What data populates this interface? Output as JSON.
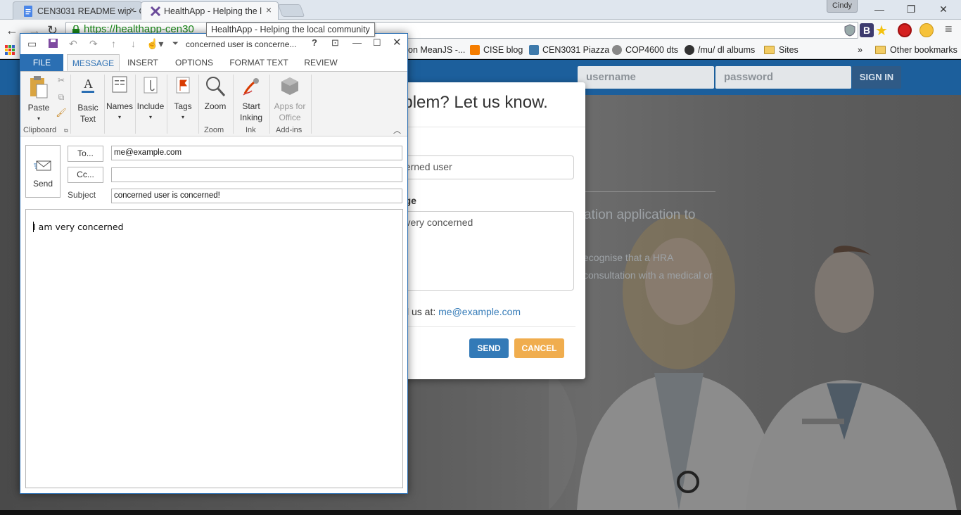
{
  "browser": {
    "tabs": [
      {
        "title": "CEN3031 README wip - C",
        "close": "×"
      },
      {
        "title": "HealthApp - Helping the l",
        "close": "×"
      }
    ],
    "profile_name": "Cindy",
    "url": "https://healthapp-cen30",
    "tooltip": "HealthApp - Helping the local community",
    "window_controls": {
      "minimize": "—",
      "restore": "❐",
      "close": "✕"
    },
    "bookmarks": [
      {
        "label": "on MeanJS -..."
      },
      {
        "label": "CISE blog"
      },
      {
        "label": "CEN3031 Piazza"
      },
      {
        "label": "COP4600 dts"
      },
      {
        "label": "/mu/ dl albums"
      },
      {
        "label": "Sites"
      }
    ],
    "overflow": "»",
    "other_bookmarks": "Other bookmarks",
    "extensions": {
      "b": "B",
      "menu": "≡"
    }
  },
  "site": {
    "username_placeholder": "username",
    "password_placeholder": "password",
    "signin_label": "SIGN IN",
    "bg_heading": "ation application to",
    "bg_line1": "ecognise that a HRA",
    "bg_line2": "consultation with a medical or"
  },
  "modal": {
    "title": "oblem? Let us know.",
    "name_label": "e",
    "name_value": "ncerned user",
    "message_label": "sage",
    "message_value": "m very concerned",
    "email_prefix": "l us at: ",
    "email_link": "me@example.com",
    "send_label": "SEND",
    "cancel_label": "CANCEL"
  },
  "outlook": {
    "title": "concerned user is concerne...",
    "help": "?",
    "tabs": [
      "FILE",
      "MESSAGE",
      "INSERT",
      "OPTIONS",
      "FORMAT TEXT",
      "REVIEW"
    ],
    "ribbon": {
      "paste": "Paste",
      "basic_text": "Basic Text",
      "names": "Names",
      "include": "Include",
      "tags": "Tags",
      "zoom": "Zoom",
      "start_inking": "Start Inking",
      "apps_for_office": "Apps for Office",
      "groups": {
        "clipboard": "Clipboard",
        "zoom": "Zoom",
        "ink": "Ink",
        "addins": "Add-ins"
      }
    },
    "send_label": "Send",
    "to_label": "To...",
    "cc_label": "Cc...",
    "subject_label": "Subject",
    "to_value": "me@example.com",
    "cc_value": "",
    "subject_value": "concerned user is concerned!",
    "body_text": "I am very concerned"
  },
  "colors": {
    "site_navbar": "#1c5f9c",
    "send_button": "#337ab7",
    "cancel_button": "#f0ad4e",
    "outlook_accent": "#2b6fb3"
  }
}
